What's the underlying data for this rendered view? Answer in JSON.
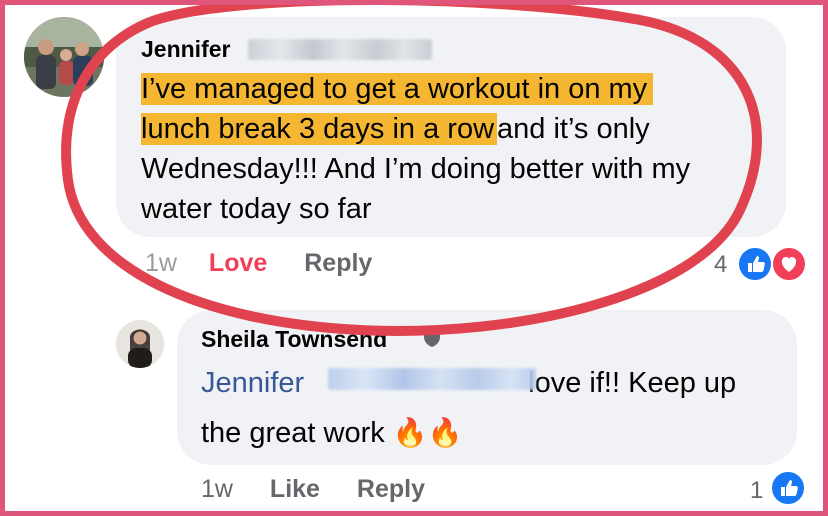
{
  "comment1": {
    "author": "Jennifer",
    "text_highlight_1": "I’ve managed to get a workout in on my",
    "text_highlight_2": "lunch break 3 days in a row",
    "text_rest_2": "and it’s only",
    "text_line_3": "Wednesday!!! And I’m doing better with my",
    "text_line_4": "water today so far",
    "time": "1w",
    "action_love": "Love",
    "action_reply": "Reply",
    "reaction_count": "4",
    "reactions": [
      "like-icon",
      "love-icon"
    ]
  },
  "comment2": {
    "author": "Sheila Townsend",
    "mention": "Jennifer",
    "text_after_mention": "love if!! Keep up",
    "text_line_2": "the great work",
    "emoji": "🔥🔥",
    "time": "1w",
    "action_like": "Like",
    "action_reply": "Reply",
    "reaction_count": "1",
    "reactions": [
      "like-icon"
    ]
  },
  "colors": {
    "highlight": "#f5b731",
    "circle_annotation": "#e0434f",
    "frame": "#e0567a",
    "love": "#f33e58",
    "mention": "#385898"
  }
}
